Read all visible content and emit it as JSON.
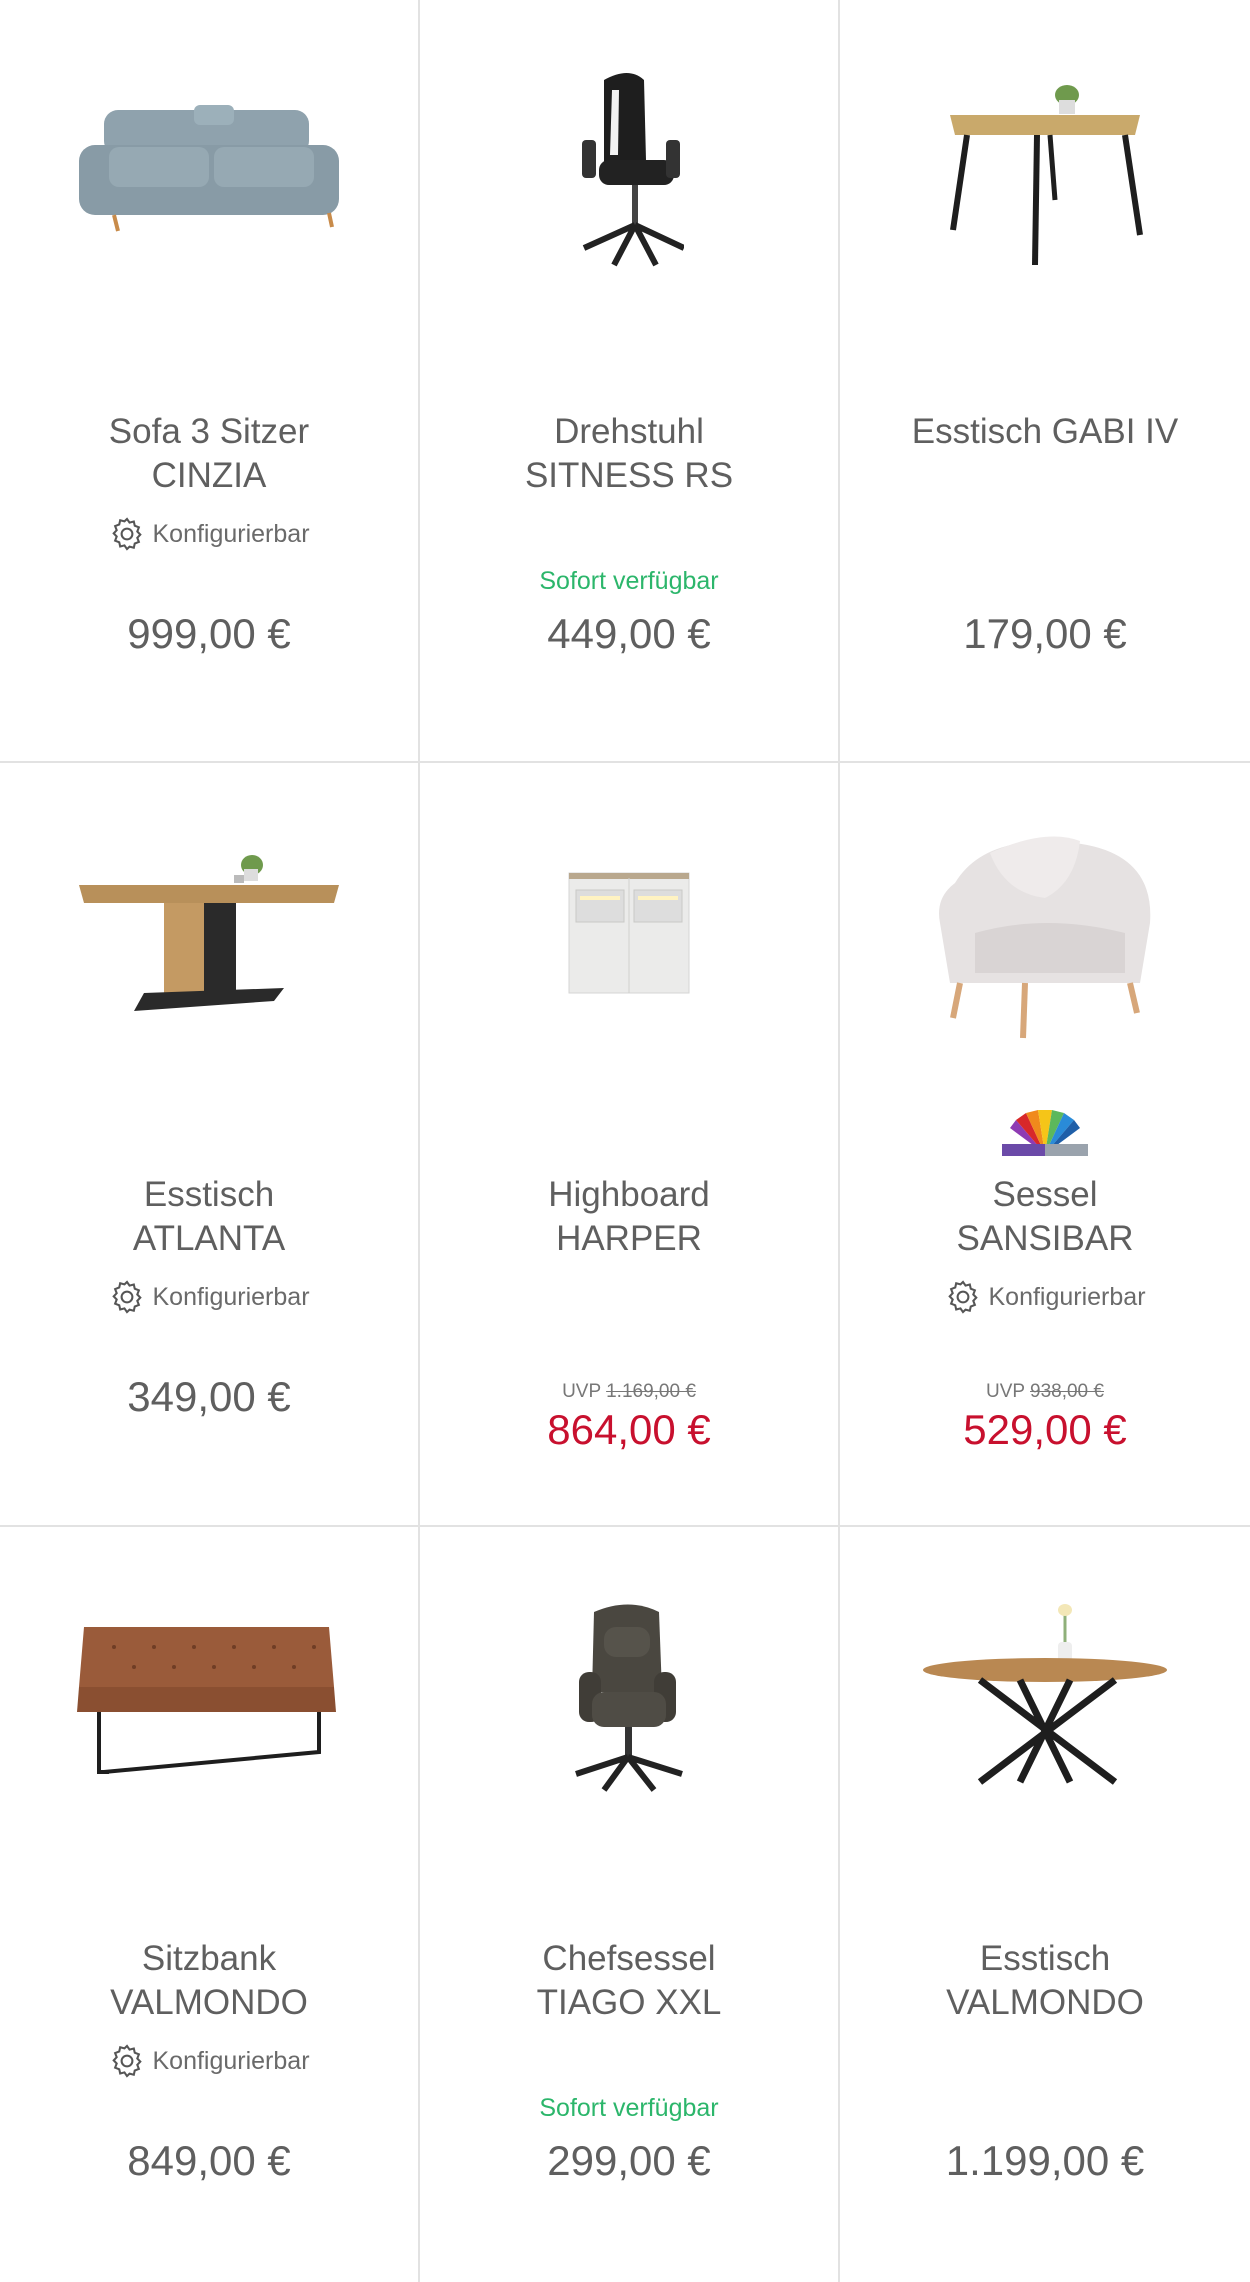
{
  "products": [
    {
      "title_line1": "Sofa 3 Sitzer",
      "title_line2": "CINZIA",
      "config": "Konfigurierbar",
      "price": "999,00 €"
    },
    {
      "title_line1": "Drehstuhl",
      "title_line2": "SITNESS RS",
      "availability": "Sofort verfügbar",
      "price": "449,00 €"
    },
    {
      "title_line1": "Esstisch GABI IV",
      "title_line2": "",
      "price": "179,00 €"
    },
    {
      "title_line1": "Esstisch",
      "title_line2": "ATLANTA",
      "config": "Konfigurierbar",
      "price": "349,00 €"
    },
    {
      "title_line1": "Highboard",
      "title_line2": "HARPER",
      "uvp_label": "UVP",
      "uvp_price": "1.169,00 €",
      "price": "864,00 €"
    },
    {
      "title_line1": "Sessel",
      "title_line2": "SANSIBAR",
      "config": "Konfigurierbar",
      "uvp_label": "UVP",
      "uvp_price": "938,00 €",
      "price": "529,00 €"
    },
    {
      "title_line1": "Sitzbank",
      "title_line2": "VALMONDO",
      "config": "Konfigurierbar",
      "price": "849,00 €"
    },
    {
      "title_line1": "Chefsessel",
      "title_line2": "TIAGO XXL",
      "availability": "Sofort verfügbar",
      "price": "299,00 €"
    },
    {
      "title_line1": "Esstisch",
      "title_line2": "VALMONDO",
      "price": "1.199,00 €"
    }
  ],
  "colors": {
    "sale": "#c8102e",
    "available": "#2cb66b",
    "divider": "#e2e2e2"
  },
  "icons": {
    "config": "gear-icon",
    "color_options": "color-fan-icon"
  }
}
